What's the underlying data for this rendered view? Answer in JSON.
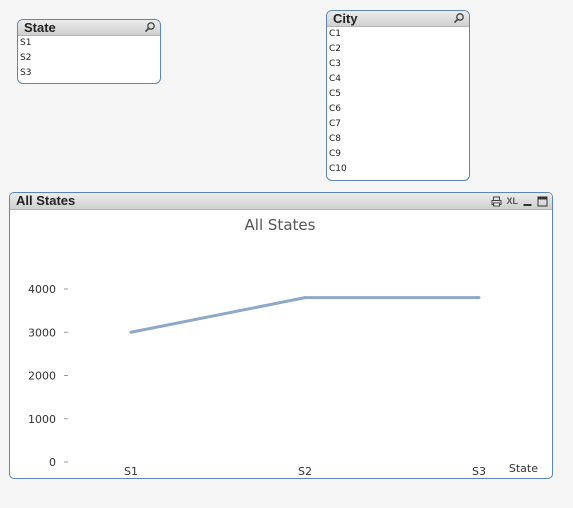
{
  "state_listbox": {
    "title": "State",
    "items": [
      "S1",
      "S2",
      "S3"
    ]
  },
  "city_listbox": {
    "title": "City",
    "items": [
      "C1",
      "C2",
      "C3",
      "C4",
      "C5",
      "C6",
      "C7",
      "C8",
      "C9",
      "C10"
    ]
  },
  "chart_object": {
    "caption": "All States",
    "caption_icons": [
      "print-icon",
      "xl-export-icon",
      "minimize-icon",
      "maximize-icon"
    ],
    "xl_label": "XL"
  },
  "chart_data": {
    "type": "line",
    "title": "All States",
    "xlabel": "State",
    "ylabel": "",
    "categories": [
      "S1",
      "S2",
      "S3"
    ],
    "values": [
      3000,
      3800,
      3800
    ],
    "ylim": [
      0,
      4000
    ],
    "yticks": [
      0,
      1000,
      2000,
      3000,
      4000
    ],
    "line_color": "#8ea9c8",
    "grid": false,
    "legend": "none"
  }
}
